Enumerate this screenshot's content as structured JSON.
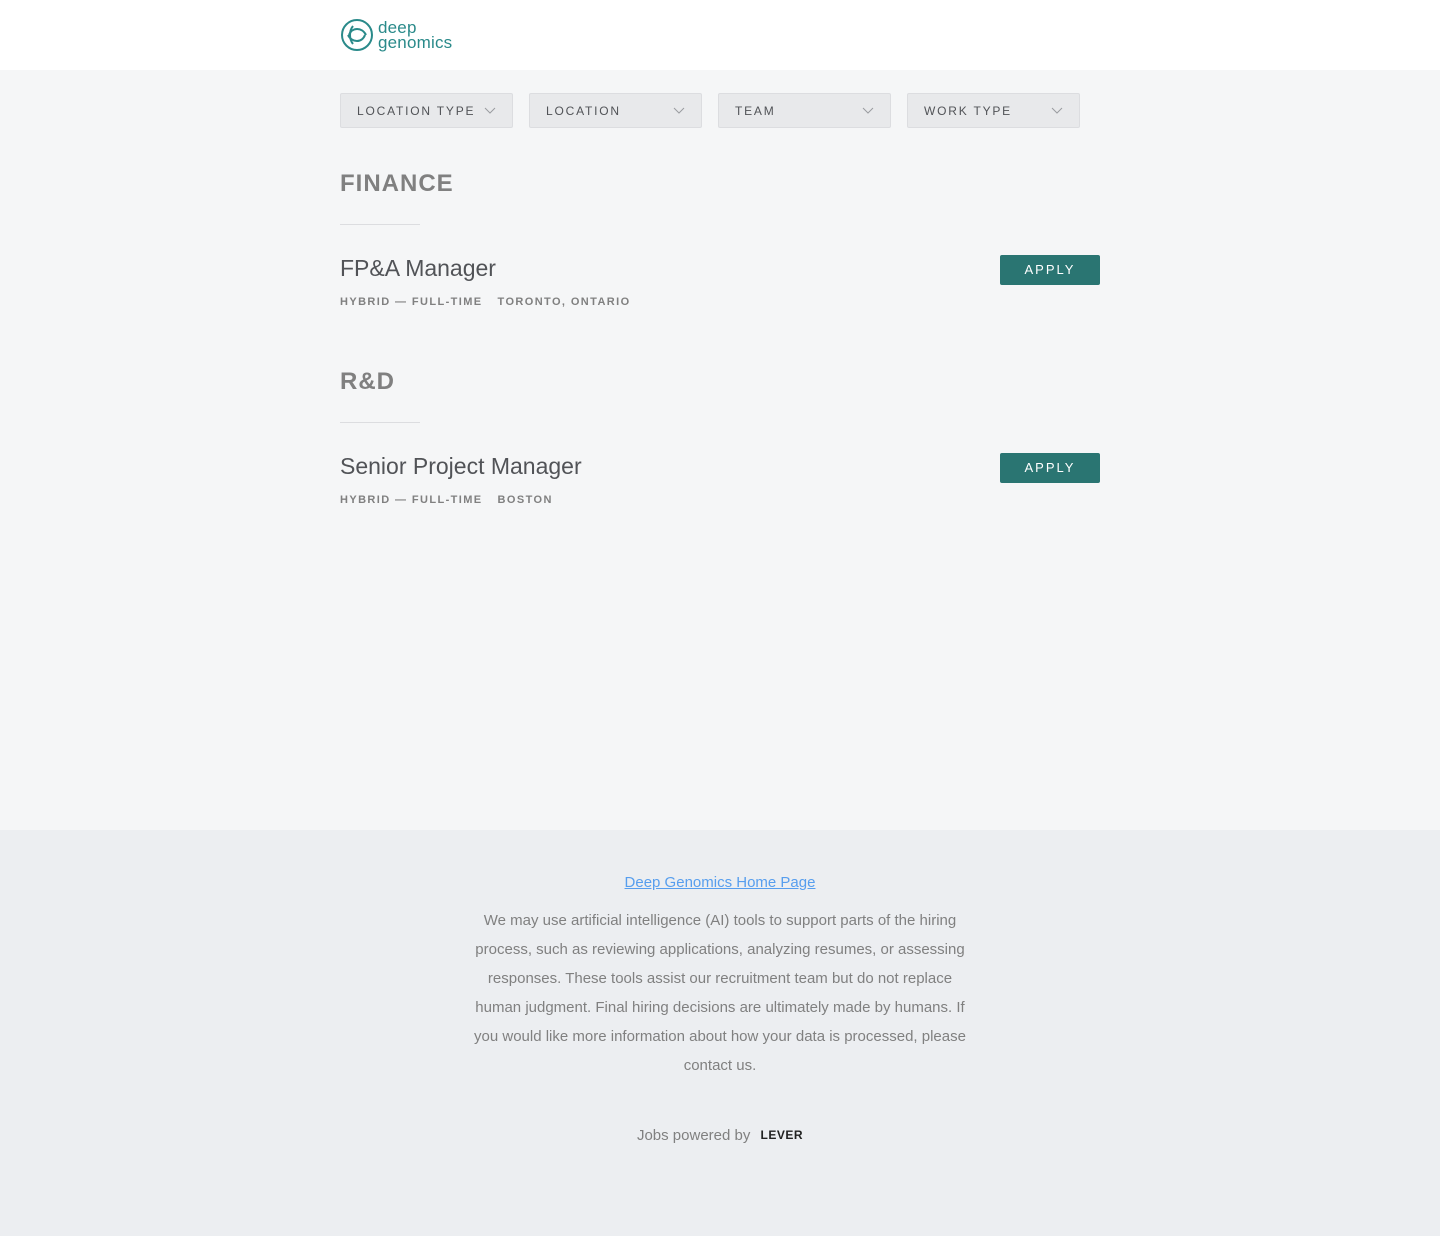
{
  "header": {
    "logo_line1": "deep",
    "logo_line2": "genomics",
    "brand_color": "#2a8a8a"
  },
  "filters": [
    {
      "label": "LOCATION TYPE"
    },
    {
      "label": "LOCATION"
    },
    {
      "label": "TEAM"
    },
    {
      "label": "WORK TYPE"
    }
  ],
  "teams": [
    {
      "name": "FINANCE",
      "postings": [
        {
          "title": "FP&A Manager",
          "commitment": "HYBRID — FULL-TIME",
          "location": "TORONTO, ONTARIO",
          "apply_label": "APPLY"
        }
      ]
    },
    {
      "name": "R&D",
      "postings": [
        {
          "title": "Senior Project Manager",
          "commitment": "HYBRID — FULL-TIME",
          "location": "BOSTON",
          "apply_label": "APPLY"
        }
      ]
    }
  ],
  "footer": {
    "home_link": "Deep Genomics Home Page",
    "ai_notice": "We may use artificial intelligence (AI) tools to support parts of the hiring process, such as reviewing applications, analyzing resumes, or assessing responses. These tools assist our recruitment team but do not replace human judgment. Final hiring decisions are ultimately made by humans. If you would like more information about how your data is processed, please contact us.",
    "powered_by": "Jobs powered by",
    "lever": "LEVER"
  },
  "colors": {
    "apply_button": "#2a7572",
    "link": "#579eee"
  }
}
